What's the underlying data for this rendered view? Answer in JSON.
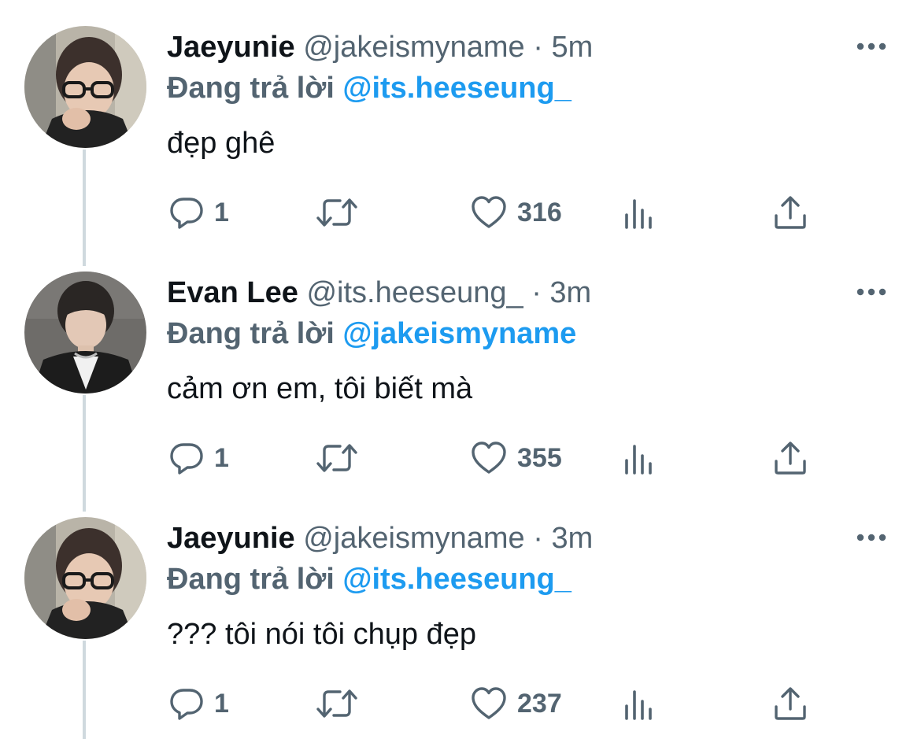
{
  "tweets": [
    {
      "display_name": "Jaeyunie",
      "handle": "@jakeismyname",
      "separator": "·",
      "time": "5m",
      "reply_prefix": "Đang trả lời",
      "reply_to": "@its.heeseung_",
      "text": "đẹp ghê",
      "replies": "1",
      "likes": "316",
      "avatar": "profile-photo-glasses"
    },
    {
      "display_name": "Evan Lee",
      "handle": "@its.heeseung_",
      "separator": "·",
      "time": "3m",
      "reply_prefix": "Đang trả lời",
      "reply_to": "@jakeismyname",
      "text": "cảm ơn em, tôi biết mà",
      "replies": "1",
      "likes": "355",
      "avatar": "profile-photo-dark-jacket"
    },
    {
      "display_name": "Jaeyunie",
      "handle": "@jakeismyname",
      "separator": "·",
      "time": "3m",
      "reply_prefix": "Đang trả lời",
      "reply_to": "@its.heeseung_",
      "text": "??? tôi nói tôi chụp đẹp",
      "replies": "1",
      "likes": "237",
      "avatar": "profile-photo-glasses"
    }
  ],
  "icons": {
    "more": "more-horizontal-icon",
    "reply": "reply-bubble-icon",
    "retweet": "retweet-icon",
    "like": "heart-icon",
    "views": "views-chart-icon",
    "share": "share-icon"
  },
  "colors": {
    "text_primary": "#0f1419",
    "text_secondary": "#536471",
    "link": "#1d9bf0",
    "thread_line": "#cfd9de"
  }
}
